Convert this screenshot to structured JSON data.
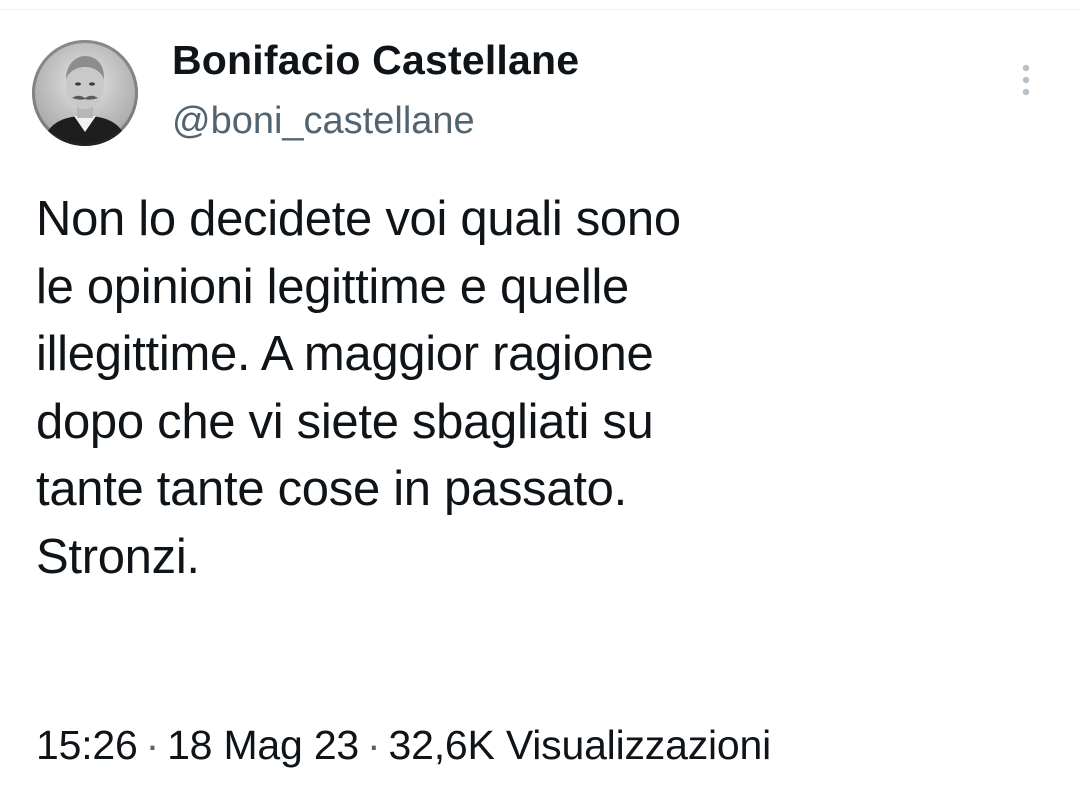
{
  "author": {
    "display_name": "Bonifacio Castellane",
    "handle": "@boni_castellane",
    "avatar": "portrait-photo"
  },
  "menu": {
    "icon": "more-vertical-icon"
  },
  "tweet": {
    "text": "Non lo decidete voi quali sono\nle opinioni legittime e quelle\nillegittime. A maggior ragione\ndopo che vi siete sbagliati su\ntante tante cose in passato.\nStronzi."
  },
  "meta": {
    "time": "15:26",
    "date": "18 Mag 23",
    "views_count": "32,6K",
    "views_label": "Visualizzazioni",
    "separator": "·"
  },
  "colors": {
    "text": "#0f1419",
    "secondary": "#536471",
    "background": "#ffffff",
    "menu_dots": "#b8c0c6"
  }
}
